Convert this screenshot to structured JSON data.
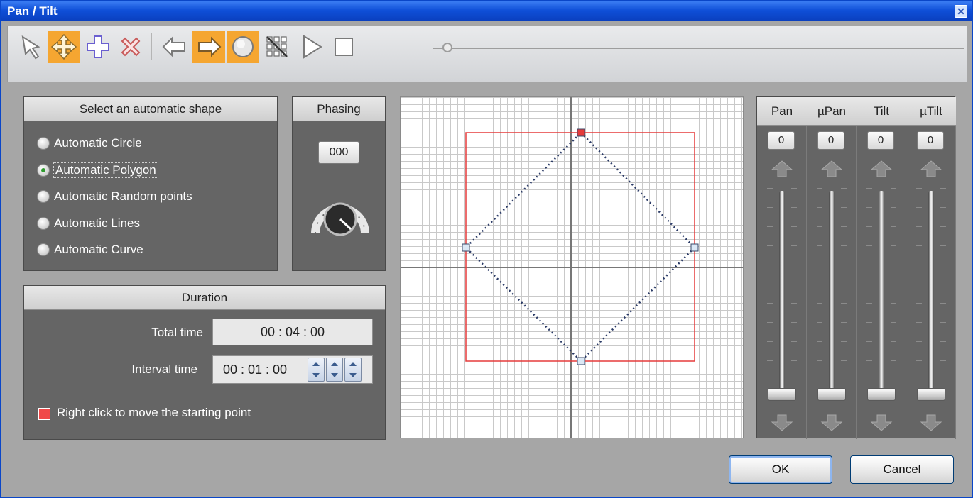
{
  "window": {
    "title": "Pan / Tilt",
    "close_glyph": "✕"
  },
  "toolbar": {
    "tools": [
      {
        "name": "select",
        "icon": "arrow-pointer-icon",
        "active": false
      },
      {
        "name": "move",
        "icon": "move-cross-icon",
        "active": true
      },
      {
        "name": "add-point",
        "icon": "plus-icon",
        "active": false
      },
      {
        "name": "delete-point",
        "icon": "delete-x-icon",
        "active": false
      },
      {
        "name": "previous",
        "icon": "arrow-left-icon",
        "active": false
      },
      {
        "name": "next",
        "icon": "arrow-right-icon",
        "active": true
      },
      {
        "name": "circle",
        "icon": "circle-icon",
        "active": true
      },
      {
        "name": "grid-off",
        "icon": "grid-crossed-icon",
        "active": false
      },
      {
        "name": "play",
        "icon": "play-icon",
        "active": false
      },
      {
        "name": "stop",
        "icon": "stop-icon",
        "active": false
      }
    ],
    "progress": 0.0,
    "accent": "#f5a631"
  },
  "shapes": {
    "header": "Select an automatic shape",
    "options": [
      {
        "label": "Automatic Circle",
        "checked": false
      },
      {
        "label": "Automatic Polygon",
        "checked": true
      },
      {
        "label": "Automatic Random points",
        "checked": false
      },
      {
        "label": "Automatic Lines",
        "checked": false
      },
      {
        "label": "Automatic Curve",
        "checked": false
      }
    ]
  },
  "phasing": {
    "header": "Phasing",
    "value": "000",
    "icon": "phasing-dial-icon"
  },
  "duration": {
    "header": "Duration",
    "total_label": "Total time",
    "total_value": "00 : 04 : 00",
    "interval_label": "Interval time",
    "interval_value": "00 : 01 : 00",
    "hint": "Right click to move the starting point",
    "hint_color": "#f04848"
  },
  "channels": [
    {
      "label": "Pan",
      "value": "0",
      "level": 0
    },
    {
      "label": "µPan",
      "value": "0",
      "level": 0
    },
    {
      "label": "Tilt",
      "value": "0",
      "level": 0
    },
    {
      "label": "µTilt",
      "value": "0",
      "level": 0
    }
  ],
  "buttons": {
    "ok": "OK",
    "cancel": "Cancel"
  },
  "colors": {
    "bounds": "#e53b3b",
    "path": "#2a3a66",
    "start_point": "#e53b3b",
    "point": "#dbe8f5"
  }
}
